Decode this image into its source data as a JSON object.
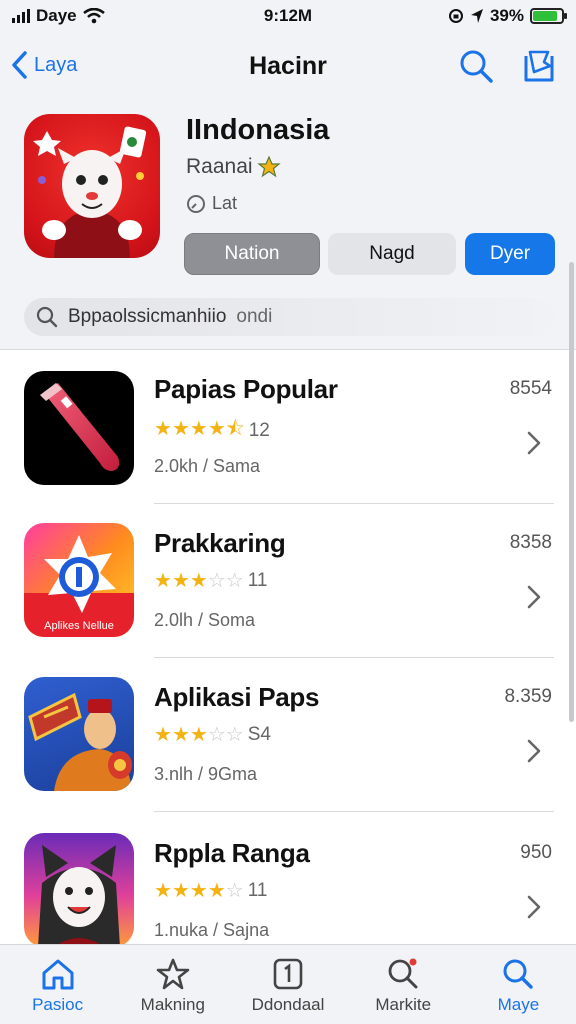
{
  "status_bar": {
    "carrier": "Daye",
    "time": "9:12M",
    "battery": "39%",
    "battery_level": 0.85
  },
  "nav": {
    "back_label": "Laya",
    "title": "Hacinr"
  },
  "hero": {
    "title": "IIndonasia",
    "subtitle": "Raanai",
    "meta": "Lat",
    "buttons": [
      "Nation",
      "Nagd",
      "Dyer"
    ]
  },
  "search": {
    "placeholder": "Bppaolssicmanhiio",
    "placeholder_tail": "ondi"
  },
  "apps": [
    {
      "name": "Papias Popular",
      "rating": 4.5,
      "count": "12",
      "meta": "2.0kh / Sama",
      "price": "8554"
    },
    {
      "name": "Prakkaring",
      "rating": 3,
      "count": "11",
      "meta": "2.0lh / Soma",
      "price": "8358",
      "icon_caption": "Aplikes Nellue"
    },
    {
      "name": "Aplikasi Paps",
      "rating": 3,
      "count": "S4",
      "meta": "3.nlh / 9Gma",
      "price": "8.359"
    },
    {
      "name": "Rppla Ranga",
      "rating": 4,
      "count": "11",
      "meta": "1.nuka / Sajna",
      "price": "950"
    }
  ],
  "tabs": [
    {
      "label": "Pasioc",
      "icon": "home-icon",
      "active": true
    },
    {
      "label": "Makning",
      "icon": "star-icon",
      "active": false
    },
    {
      "label": "Ddondaal",
      "icon": "apps-icon",
      "active": false
    },
    {
      "label": "Markite",
      "icon": "search-icon",
      "active": false
    },
    {
      "label": "Maye",
      "icon": "search-icon",
      "active": true
    }
  ],
  "colors": {
    "accent": "#1a73e8",
    "star": "#f3b313",
    "hero_bg": "#d4141a"
  }
}
